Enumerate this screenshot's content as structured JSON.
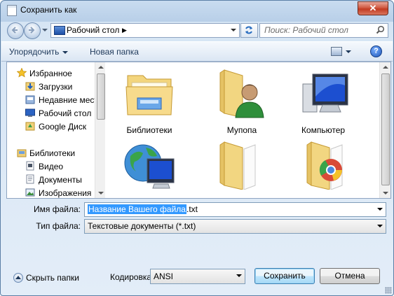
{
  "window": {
    "title": "Сохранить как",
    "close_label": "✕"
  },
  "address": {
    "location": "Рабочий стол",
    "search_placeholder": "Поиск: Рабочий стол"
  },
  "toolbar": {
    "organize_label": "Упорядочить",
    "new_folder_label": "Новая папка",
    "help_label": "?"
  },
  "nav": {
    "items": [
      {
        "label": "Избранное",
        "icon": "star-icon"
      },
      {
        "label": "Загрузки",
        "icon": "downloads-icon"
      },
      {
        "label": "Недавние места",
        "icon": "recent-places-icon"
      },
      {
        "label": "Рабочий стол",
        "icon": "desktop-icon"
      },
      {
        "label": "Google Диск",
        "icon": "google-drive-icon"
      },
      {
        "label": "Библиотеки",
        "icon": "libraries-icon"
      },
      {
        "label": "Видео",
        "icon": "video-icon"
      },
      {
        "label": "Документы",
        "icon": "documents-icon"
      },
      {
        "label": "Изображения",
        "icon": "images-icon"
      }
    ]
  },
  "files": {
    "items": [
      {
        "label": "Библиотеки",
        "icon": "libraries-folder-icon"
      },
      {
        "label": "Мупопа",
        "icon": "user-folder-icon"
      },
      {
        "label": "Компьютер",
        "icon": "computer-icon"
      },
      {
        "label": "",
        "icon": "network-icon"
      },
      {
        "label": "",
        "icon": "folder-icon"
      },
      {
        "label": "",
        "icon": "chrome-folder-icon"
      }
    ]
  },
  "form": {
    "filename_label": "Имя файла:",
    "filename_selected": "Название Вашего файла",
    "filename_ext": ".txt",
    "filetype_label": "Тип файла:",
    "filetype_value": "Текстовые документы (*.txt)",
    "encoding_label": "Кодировка:",
    "encoding_value": "ANSI"
  },
  "footer": {
    "hide_folders_label": "Скрыть папки",
    "save_label": "Сохранить",
    "cancel_label": "Отмена"
  },
  "colors": {
    "selection": "#3399ff",
    "title_bar": "#c9dcf0",
    "close_button": "#c23b22"
  }
}
